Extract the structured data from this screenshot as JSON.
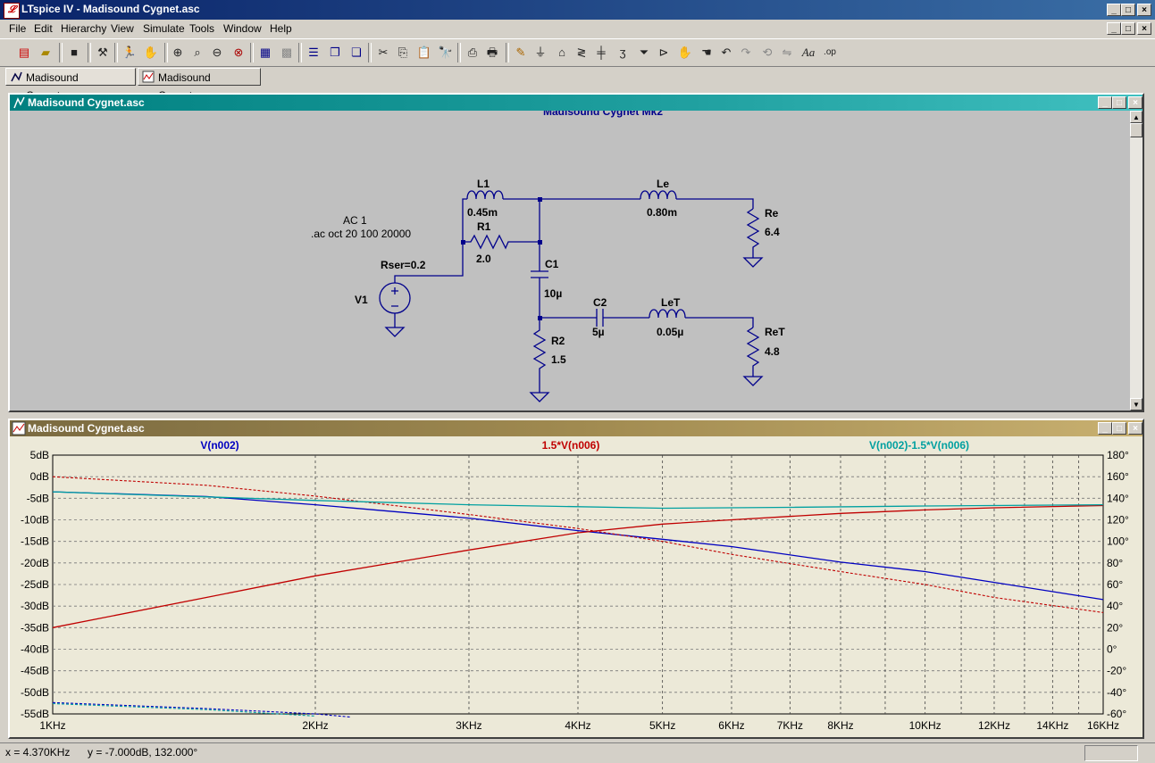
{
  "app": {
    "title": "LTspice IV - Madisound Cygnet.asc",
    "logo_letter": "𝓛"
  },
  "menu": [
    {
      "label": "File",
      "accel": "F"
    },
    {
      "label": "Edit",
      "accel": "E"
    },
    {
      "label": "Hierarchy",
      "accel": "i"
    },
    {
      "label": "View",
      "accel": "V"
    },
    {
      "label": "Simulate",
      "accel": "S"
    },
    {
      "label": "Tools",
      "accel": "T"
    },
    {
      "label": "Window",
      "accel": "W"
    },
    {
      "label": "Help",
      "accel": "H"
    }
  ],
  "toolbar": {
    "icons": [
      "new-schematic-icon",
      "open-icon",
      "save-icon",
      "control-panel-icon",
      "run-icon",
      "halt-icon",
      "zoom-in-icon",
      "zoom-area-icon",
      "zoom-out-icon",
      "zoom-cancel-icon",
      "autorange-icon",
      "grid-icon",
      "tile-horizontal-icon",
      "cascade-icon",
      "tile-vertical-icon",
      "cut-icon",
      "copy-icon",
      "paste-icon",
      "find-icon",
      "print-preview-icon",
      "print-icon",
      "wire-icon",
      "ground-icon",
      "label-icon",
      "resistor-icon",
      "capacitor-icon",
      "inductor-icon",
      "diode-icon",
      "component-icon",
      "move-icon",
      "drag-icon",
      "undo-icon",
      "redo-icon",
      "rotate-icon",
      "mirror-icon",
      "text-icon",
      "spice-directive-icon"
    ],
    "text_tool_label": "Aa",
    "directive_label": ".op"
  },
  "tabs": [
    {
      "label": "Madisound Cygnet.asc",
      "kind": "schematic",
      "active": true
    },
    {
      "label": "Madisound Cygnet.asc",
      "kind": "waveform",
      "active": false
    }
  ],
  "schematic_window": {
    "title": "Madisound Cygnet.asc",
    "header_text": "Madisound Cygnet Mk2",
    "directives": {
      "ac_source": "AC 1",
      "ac_cmd": ".ac oct 20 100 20000"
    },
    "source": {
      "name": "V1",
      "param": "Rser=0.2"
    },
    "components": [
      {
        "name": "L1",
        "value": "0.45m"
      },
      {
        "name": "R1",
        "value": "2.0"
      },
      {
        "name": "Le",
        "value": "0.80m"
      },
      {
        "name": "Re",
        "value": "6.4"
      },
      {
        "name": "C1",
        "value": "10µ"
      },
      {
        "name": "C2",
        "value": "5µ"
      },
      {
        "name": "LeT",
        "value": "0.05µ"
      },
      {
        "name": "ReT",
        "value": "4.8"
      },
      {
        "name": "R2",
        "value": "1.5"
      }
    ]
  },
  "plot_window": {
    "title": "Madisound Cygnet.asc"
  },
  "chart_data": {
    "type": "line",
    "xscale": "log",
    "xlim": [
      1000,
      16000
    ],
    "ylim_db": [
      -55,
      5
    ],
    "ylim_phase": [
      -60,
      180
    ],
    "x_ticks": [
      {
        "v": 1000,
        "label": "1KHz"
      },
      {
        "v": 2000,
        "label": "2KHz"
      },
      {
        "v": 3000,
        "label": "3KHz"
      },
      {
        "v": 4000,
        "label": "4KHz"
      },
      {
        "v": 5000,
        "label": "5KHz"
      },
      {
        "v": 6000,
        "label": "6KHz"
      },
      {
        "v": 7000,
        "label": "7KHz"
      },
      {
        "v": 8000,
        "label": "8KHz"
      },
      {
        "v": 10000,
        "label": "10KHz"
      },
      {
        "v": 12000,
        "label": "12KHz"
      },
      {
        "v": 14000,
        "label": "14KHz"
      },
      {
        "v": 16000,
        "label": "16KHz"
      }
    ],
    "x_minor_ticks": [
      9000,
      11000,
      13000,
      15000
    ],
    "y_left_ticks": [
      "5dB",
      "0dB",
      "-5dB",
      "-10dB",
      "-15dB",
      "-20dB",
      "-25dB",
      "-30dB",
      "-35dB",
      "-40dB",
      "-45dB",
      "-50dB",
      "-55dB"
    ],
    "y_left_values": [
      5,
      0,
      -5,
      -10,
      -15,
      -20,
      -25,
      -30,
      -35,
      -40,
      -45,
      -50,
      -55
    ],
    "y_right_ticks": [
      "180°",
      "160°",
      "140°",
      "120°",
      "100°",
      "80°",
      "60°",
      "40°",
      "20°",
      "0°",
      "-20°",
      "-40°",
      "-60°"
    ],
    "y_right_values": [
      180,
      160,
      140,
      120,
      100,
      80,
      60,
      40,
      20,
      0,
      -20,
      -40,
      -60
    ],
    "grid": true,
    "series": [
      {
        "name": "V(n002)",
        "color": "#0000c0",
        "label_pos": "left",
        "mag": [
          [
            1000,
            -3.5
          ],
          [
            1500,
            -4.6
          ],
          [
            2000,
            -6.5
          ],
          [
            3000,
            -9.6
          ],
          [
            4000,
            -12.5
          ],
          [
            5000,
            -14.5
          ],
          [
            6000,
            -16.2
          ],
          [
            8000,
            -19.8
          ],
          [
            10000,
            -22.0
          ],
          [
            12000,
            -24.5
          ],
          [
            16000,
            -28.5
          ]
        ],
        "phase": [
          [
            1000,
            -49.5
          ],
          [
            1500,
            -55
          ],
          [
            2000,
            -60
          ],
          [
            2200,
            -63
          ]
        ]
      },
      {
        "name": "1.5*V(n006)",
        "color": "#c00000",
        "label_pos": "center",
        "mag": [
          [
            1000,
            -35
          ],
          [
            1500,
            -28
          ],
          [
            2000,
            -23
          ],
          [
            3000,
            -17
          ],
          [
            4000,
            -13
          ],
          [
            5000,
            -11
          ],
          [
            6000,
            -10
          ],
          [
            8000,
            -8.5
          ],
          [
            10000,
            -7.7
          ],
          [
            12000,
            -7.2
          ],
          [
            16000,
            -6.7
          ]
        ],
        "phase": [
          [
            1000,
            160
          ],
          [
            1500,
            152
          ],
          [
            2000,
            142
          ],
          [
            3000,
            125
          ],
          [
            4000,
            112
          ],
          [
            5000,
            100
          ],
          [
            6000,
            88
          ],
          [
            8000,
            72
          ],
          [
            10000,
            60
          ],
          [
            12000,
            48
          ],
          [
            16000,
            34
          ]
        ]
      },
      {
        "name": "V(n002)-1.5*V(n006)",
        "color": "#00a0a0",
        "label_pos": "right",
        "mag": [
          [
            1000,
            -3.5
          ],
          [
            2000,
            -5.5
          ],
          [
            3000,
            -6.5
          ],
          [
            5000,
            -7.3
          ],
          [
            7000,
            -7.1
          ],
          [
            10000,
            -6.8
          ],
          [
            16000,
            -6.5
          ]
        ],
        "phase": [
          [
            1000,
            -50.5
          ],
          [
            1500,
            -56
          ],
          [
            2000,
            -62
          ]
        ]
      }
    ]
  },
  "status": {
    "x": "x = 4.370KHz",
    "y": "y = -7.000dB, 132.000°"
  }
}
